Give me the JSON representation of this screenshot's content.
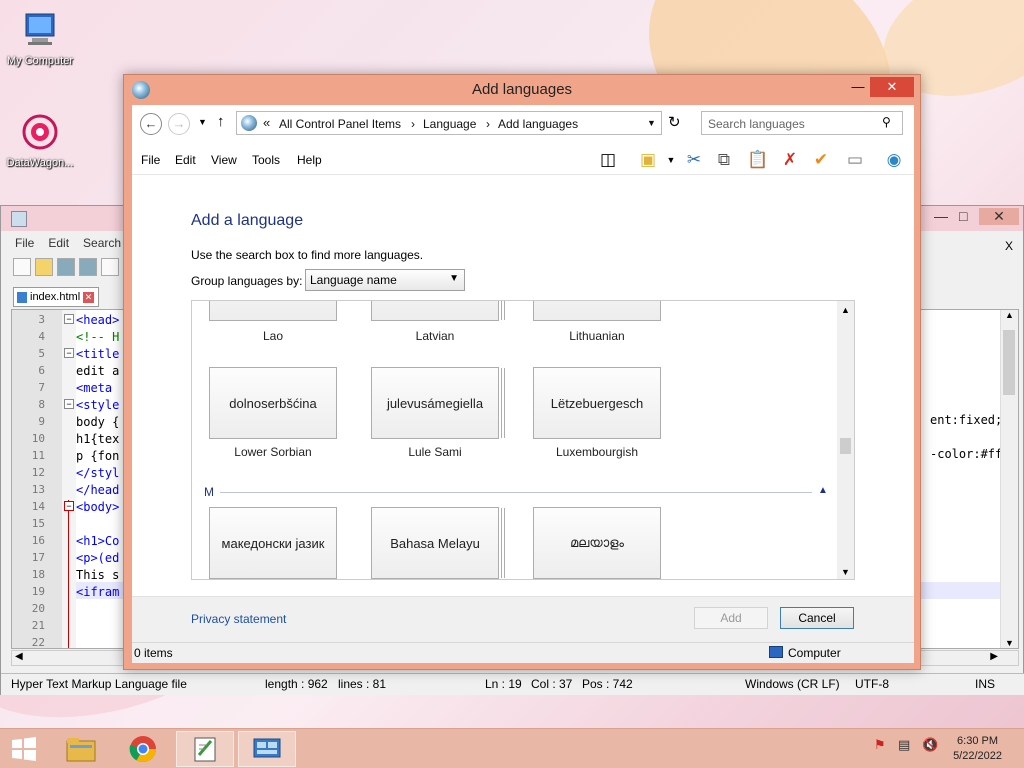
{
  "desktop": {
    "icons": [
      {
        "label": "My Computer"
      },
      {
        "label": "DataWagon..."
      }
    ]
  },
  "notepadpp": {
    "menu": [
      "File",
      "Edit",
      "Search"
    ],
    "tab_label": "index.html",
    "line_numbers": [
      "3",
      "4",
      "5",
      "6",
      "7",
      "8",
      "9",
      "10",
      "11",
      "12",
      "13",
      "14",
      "15",
      "16",
      "17",
      "18",
      "19",
      "20",
      "21",
      "22"
    ],
    "code_lines": [
      "<head>",
      "<!-- H",
      "<title",
      "edit a",
      "<meta ",
      "<style",
      "body {",
      "h1{tex",
      "p {fon",
      "</styl",
      "</head",
      "<body>",
      "",
      "<h1>Co",
      "<p>(ed",
      "This s",
      "<ifram",
      "",
      "",
      ""
    ],
    "right_code": {
      "line9": "ent:fixed;",
      "line11": "-color:#ff"
    },
    "status": {
      "type": "Hyper Text Markup Language file",
      "length": "length : 962",
      "lines": "lines : 81",
      "ln": "Ln : 19",
      "col": "Col : 37",
      "pos": "Pos : 742",
      "eol": "Windows (CR LF)",
      "encoding": "UTF-8",
      "mode": "INS"
    }
  },
  "window": {
    "title": "Add languages",
    "breadcrumb": [
      "All Control Panel Items",
      "Language",
      "Add languages"
    ],
    "breadcrumb_prefix": "«",
    "search_placeholder": "Search languages",
    "menu": [
      "File",
      "Edit",
      "View",
      "Tools",
      "Help"
    ],
    "heading": "Add a language",
    "hint": "Use the search box to find more languages.",
    "group_by_label": "Group languages by:",
    "group_by_value": "Language name",
    "section_m": "M",
    "top_row_captions": [
      "Lao",
      "Latvian",
      "Lithuanian"
    ],
    "row2": [
      {
        "tile": "dolnoserbšćina",
        "caption": "Lower Sorbian"
      },
      {
        "tile": "julevusámegiella",
        "caption": "Lule Sami"
      },
      {
        "tile": "Lëtzebuergesch",
        "caption": "Luxembourgish"
      }
    ],
    "row3": [
      {
        "tile": "македонски јазик",
        "caption": ""
      },
      {
        "tile": "Bahasa Melayu",
        "caption": ""
      },
      {
        "tile": "മലയാളം",
        "caption": ""
      }
    ],
    "privacy": "Privacy statement",
    "add_button": "Add",
    "cancel_button": "Cancel",
    "status_items": "0 items",
    "status_computer": "Computer"
  },
  "taskbar": {
    "time": "6:30 PM",
    "date": "5/22/2022"
  },
  "colors": {
    "window_frame": "#f0a58a",
    "heading": "#1e3287",
    "link": "#1e4fa0",
    "taskbar": "#e9b7a6"
  }
}
